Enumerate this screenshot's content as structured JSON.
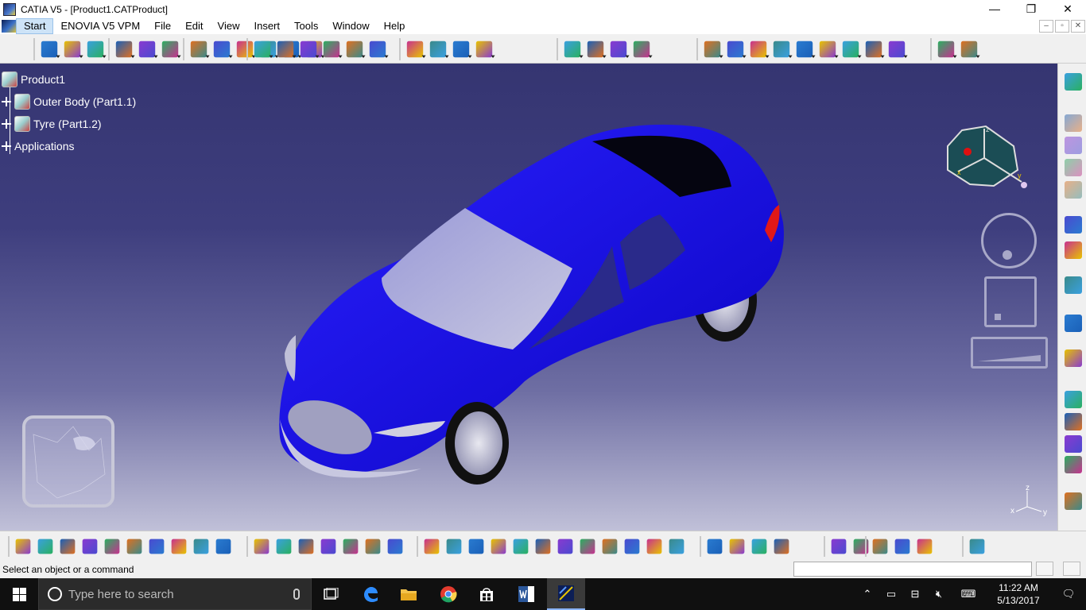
{
  "window": {
    "title": "CATIA V5 - [Product1.CATProduct]",
    "controls": [
      "—",
      "❐",
      "✕"
    ],
    "mdi_controls": [
      "–",
      "▫",
      "✕"
    ]
  },
  "menu": {
    "items": [
      "Start",
      "ENOVIA V5 VPM",
      "File",
      "Edit",
      "View",
      "Insert",
      "Tools",
      "Window",
      "Help"
    ],
    "active": "Start"
  },
  "tree": {
    "root": "Product1",
    "children": [
      "Outer Body (Part1.1)",
      "Tyre (Part1.2)"
    ],
    "applications": "Applications"
  },
  "compass": {
    "axis_x": "x",
    "axis_y": "y",
    "axis_z": "z"
  },
  "mini_axis": {
    "x": "x",
    "y": "y",
    "z": "z"
  },
  "status": {
    "message": "Select an object or a command",
    "command_input": ""
  },
  "taskbar": {
    "search_placeholder": "Type here to search",
    "time": "11:22 AM",
    "date": "5/13/2017"
  },
  "colors": {
    "car_body": "#1a10e8",
    "viewport_top": "#353571",
    "viewport_bottom": "#c0c0d8",
    "accent_yellow": "#e8c400",
    "accent_blue": "#2a7bd0"
  },
  "toolbar_icons": {
    "top": [
      "point-icon",
      "line-icon",
      "plane-icon",
      "extrude-icon",
      "revolve-icon",
      "sphere-icon",
      "circle-icon",
      "spline-icon",
      "sweep-icon",
      "fill-icon",
      "blend-icon",
      "offset-icon",
      "join-icon",
      "split-icon",
      "trim-icon",
      "boundary-icon",
      "extract-icon",
      "fillet-icon",
      "translate-icon",
      "pattern-icon",
      "extrapolate-icon",
      "near-icon",
      "axis-system-icon",
      "grid-icon",
      "sheet-metal-icon",
      "pocket-icon",
      "pad-icon",
      "shaft-icon",
      "groove-icon",
      "hole-icon",
      "rib-icon",
      "slot-icon",
      "solid-icon",
      "thickness-icon",
      "shell-icon",
      "draft-icon",
      "assembly-icon"
    ],
    "bottom": [
      "new-icon",
      "open-icon",
      "save-icon",
      "print-icon",
      "cut-icon",
      "copy-icon",
      "paste-icon",
      "undo-icon",
      "redo-icon",
      "whats-this-icon",
      "formula-icon",
      "knowledge-icon",
      "macro-icon",
      "table-icon",
      "graph-icon",
      "lock-icon",
      "list-icon",
      "fly-mode-icon",
      "fit-all-icon",
      "pan-icon",
      "rotate-icon",
      "zoom-in-icon",
      "zoom-out-icon",
      "normal-view-icon",
      "multi-view-icon",
      "iso-view-icon",
      "hide-show-icon",
      "swap-icon",
      "render-icon",
      "measure-icon",
      "measure-item-icon",
      "inertia-icon",
      "capture-icon",
      "apply-material-icon",
      "catalog-icon",
      "constraint-icon",
      "analysis-icon",
      "text-abc-icon",
      "catia-logo-icon"
    ]
  }
}
